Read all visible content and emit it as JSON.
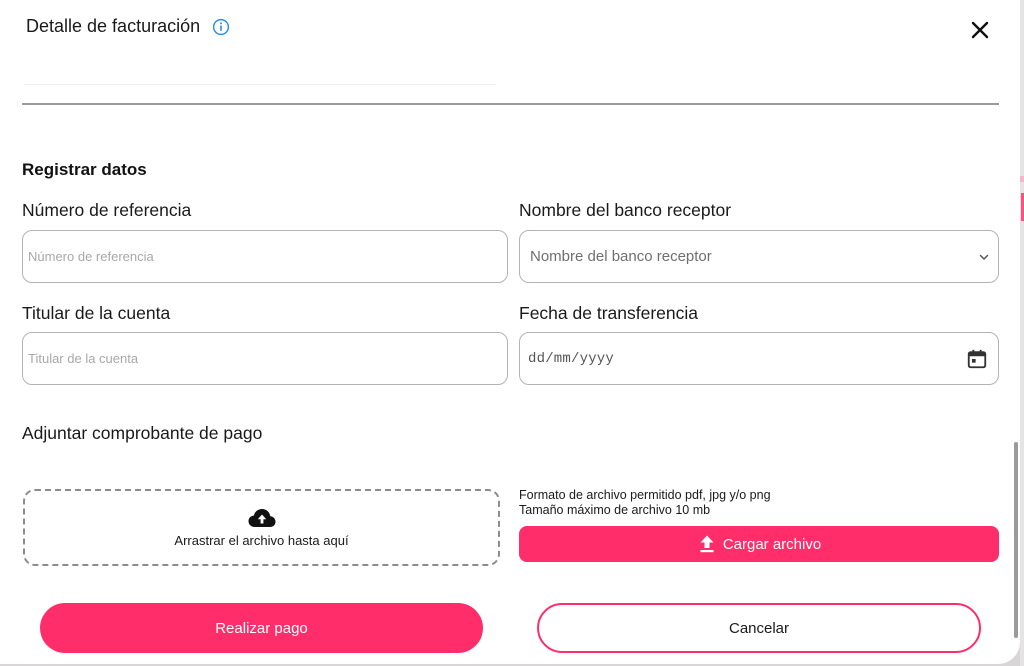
{
  "header": {
    "title": "Detalle de facturación"
  },
  "form": {
    "section_title": "Registrar datos",
    "reference": {
      "label": "Número de referencia",
      "placeholder": "Número de referencia"
    },
    "bank": {
      "label": "Nombre del banco receptor",
      "selected": "Nombre del banco receptor"
    },
    "holder": {
      "label": "Titular de la cuenta",
      "placeholder": "Titular de la cuenta"
    },
    "date": {
      "label": "Fecha de transferencia",
      "value": "dd/mm/yyyy"
    }
  },
  "attachment": {
    "label": "Adjuntar comprobante de pago",
    "dropzone_text": "Arrastrar el archivo hasta aquí",
    "format_hint": "Formato de archivo permitido pdf, jpg y/o png",
    "size_hint": "Tamaño máximo de archivo 10 mb",
    "upload_label": "Cargar archivo"
  },
  "actions": {
    "pay_label": "Realizar pago",
    "cancel_label": "Cancelar"
  },
  "colors": {
    "accent": "#ff2d69",
    "info": "#2a8de8"
  },
  "icons": [
    "info-icon",
    "close-icon",
    "chevron-down-icon",
    "calendar-icon",
    "cloud-upload-icon",
    "upload-icon"
  ]
}
